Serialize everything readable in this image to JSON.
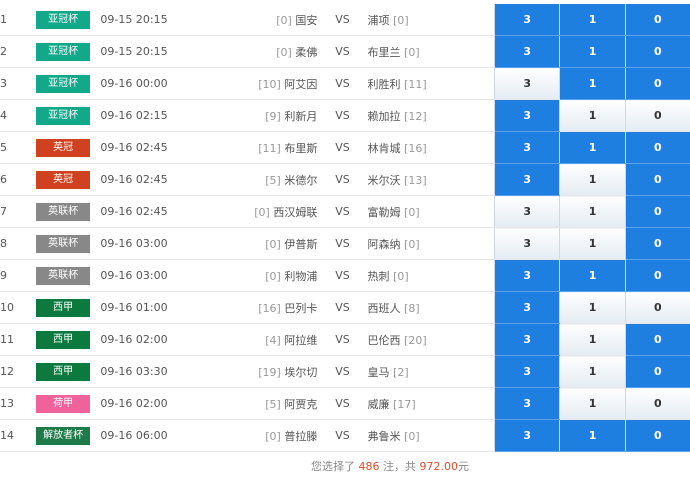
{
  "colors": {
    "亚冠杯": "#12a88a",
    "英冠": "#d0421f",
    "英联杯": "#888888",
    "西甲": "#0c7a3e",
    "荷甲": "#f0629a",
    "解放者杯": "#1f7a4a",
    "selected": "#1e7fe0"
  },
  "matches": [
    {
      "num": "1",
      "league": "亚冠杯",
      "time": "09-15 20:15",
      "home_rank": "[0]",
      "home": "国安",
      "vs": "VS",
      "away": "浦项",
      "away_rank": "[0]",
      "opts": [
        {
          "label": "3",
          "sel": true
        },
        {
          "label": "1",
          "sel": true
        },
        {
          "label": "0",
          "sel": true
        }
      ]
    },
    {
      "num": "2",
      "league": "亚冠杯",
      "time": "09-15 20:15",
      "home_rank": "[0]",
      "home": "柔佛",
      "vs": "VS",
      "away": "布里兰",
      "away_rank": "[0]",
      "opts": [
        {
          "label": "3",
          "sel": true
        },
        {
          "label": "1",
          "sel": true
        },
        {
          "label": "0",
          "sel": true
        }
      ]
    },
    {
      "num": "3",
      "league": "亚冠杯",
      "time": "09-16 00:00",
      "home_rank": "[10]",
      "home": "阿艾因",
      "vs": "VS",
      "away": "利胜利",
      "away_rank": "[11]",
      "opts": [
        {
          "label": "3",
          "sel": false
        },
        {
          "label": "1",
          "sel": true
        },
        {
          "label": "0",
          "sel": true
        }
      ]
    },
    {
      "num": "4",
      "league": "亚冠杯",
      "time": "09-16 02:15",
      "home_rank": "[9]",
      "home": "利新月",
      "vs": "VS",
      "away": "赖加拉",
      "away_rank": "[12]",
      "opts": [
        {
          "label": "3",
          "sel": true
        },
        {
          "label": "1",
          "sel": false
        },
        {
          "label": "0",
          "sel": false
        }
      ]
    },
    {
      "num": "5",
      "league": "英冠",
      "time": "09-16 02:45",
      "home_rank": "[11]",
      "home": "布里斯",
      "vs": "VS",
      "away": "林肯城",
      "away_rank": "[16]",
      "opts": [
        {
          "label": "3",
          "sel": true
        },
        {
          "label": "1",
          "sel": true
        },
        {
          "label": "0",
          "sel": true
        }
      ]
    },
    {
      "num": "6",
      "league": "英冠",
      "time": "09-16 02:45",
      "home_rank": "[5]",
      "home": "米德尔",
      "vs": "VS",
      "away": "米尔沃",
      "away_rank": "[13]",
      "opts": [
        {
          "label": "3",
          "sel": true
        },
        {
          "label": "1",
          "sel": false
        },
        {
          "label": "0",
          "sel": true
        }
      ]
    },
    {
      "num": "7",
      "league": "英联杯",
      "time": "09-16 02:45",
      "home_rank": "[0]",
      "home": "西汉姆联",
      "vs": "VS",
      "away": "富勒姆",
      "away_rank": "[0]",
      "opts": [
        {
          "label": "3",
          "sel": false
        },
        {
          "label": "1",
          "sel": false
        },
        {
          "label": "0",
          "sel": true
        }
      ]
    },
    {
      "num": "8",
      "league": "英联杯",
      "time": "09-16 03:00",
      "home_rank": "[0]",
      "home": "伊普斯",
      "vs": "VS",
      "away": "阿森纳",
      "away_rank": "[0]",
      "opts": [
        {
          "label": "3",
          "sel": false
        },
        {
          "label": "1",
          "sel": false
        },
        {
          "label": "0",
          "sel": true
        }
      ]
    },
    {
      "num": "9",
      "league": "英联杯",
      "time": "09-16 03:00",
      "home_rank": "[0]",
      "home": "利物浦",
      "vs": "VS",
      "away": "热刺",
      "away_rank": "[0]",
      "opts": [
        {
          "label": "3",
          "sel": true
        },
        {
          "label": "1",
          "sel": true
        },
        {
          "label": "0",
          "sel": true
        }
      ]
    },
    {
      "num": "10",
      "league": "西甲",
      "time": "09-16 01:00",
      "home_rank": "[16]",
      "home": "巴列卡",
      "vs": "VS",
      "away": "西班人",
      "away_rank": "[8]",
      "opts": [
        {
          "label": "3",
          "sel": true
        },
        {
          "label": "1",
          "sel": false
        },
        {
          "label": "0",
          "sel": false
        }
      ]
    },
    {
      "num": "11",
      "league": "西甲",
      "time": "09-16 02:00",
      "home_rank": "[4]",
      "home": "阿拉维",
      "vs": "VS",
      "away": "巴伦西",
      "away_rank": "[20]",
      "opts": [
        {
          "label": "3",
          "sel": true
        },
        {
          "label": "1",
          "sel": false
        },
        {
          "label": "0",
          "sel": true
        }
      ]
    },
    {
      "num": "12",
      "league": "西甲",
      "time": "09-16 03:30",
      "home_rank": "[19]",
      "home": "埃尔切",
      "vs": "VS",
      "away": "皇马",
      "away_rank": "[2]",
      "opts": [
        {
          "label": "3",
          "sel": true
        },
        {
          "label": "1",
          "sel": false
        },
        {
          "label": "0",
          "sel": true
        }
      ]
    },
    {
      "num": "13",
      "league": "荷甲",
      "time": "09-16 02:00",
      "home_rank": "[5]",
      "home": "阿贾克",
      "vs": "VS",
      "away": "威廉",
      "away_rank": "[17]",
      "opts": [
        {
          "label": "3",
          "sel": true
        },
        {
          "label": "1",
          "sel": false
        },
        {
          "label": "0",
          "sel": false
        }
      ]
    },
    {
      "num": "14",
      "league": "解放者杯",
      "time": "09-16 06:00",
      "home_rank": "[0]",
      "home": "普拉滕",
      "vs": "VS",
      "away": "弗鲁米",
      "away_rank": "[0]",
      "opts": [
        {
          "label": "3",
          "sel": true
        },
        {
          "label": "1",
          "sel": true
        },
        {
          "label": "0",
          "sel": true
        }
      ]
    }
  ],
  "footer": {
    "prefix": "您选择了",
    "count": "486",
    "middle": "注，共",
    "amount": "972.00",
    "suffix": "元"
  }
}
